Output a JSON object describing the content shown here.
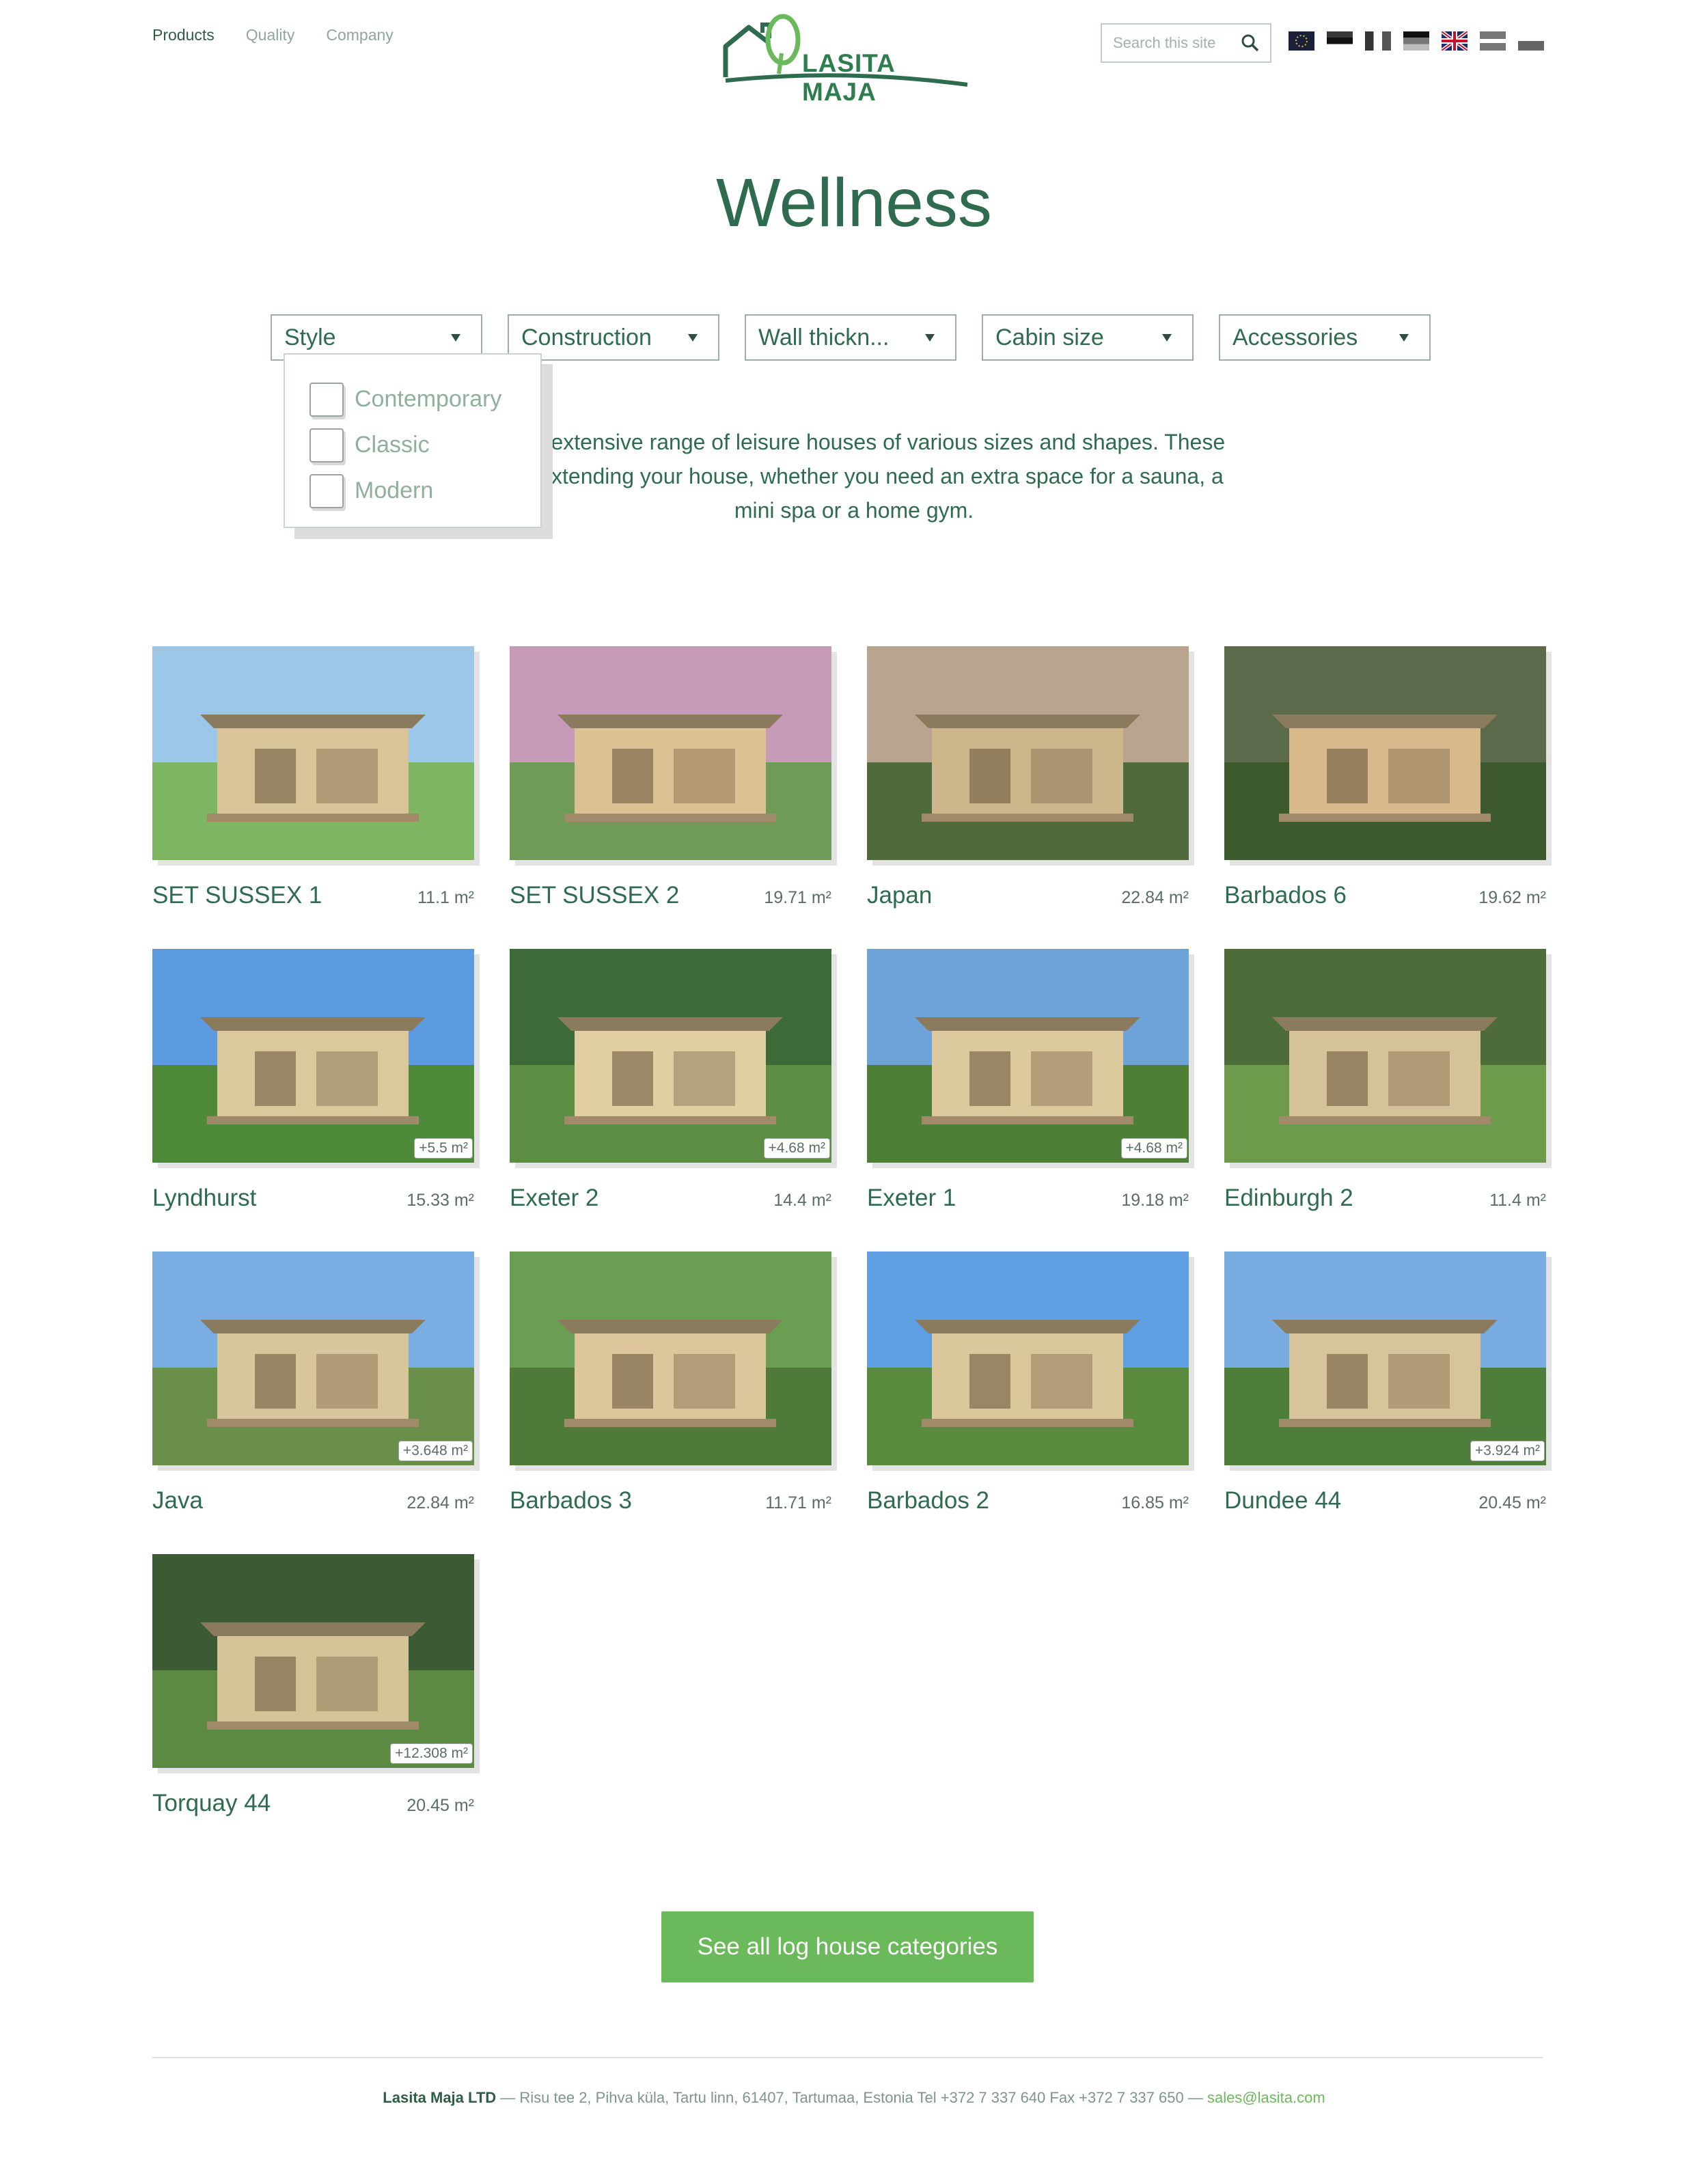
{
  "nav": {
    "items": [
      "Products",
      "Quality",
      "Company"
    ]
  },
  "logo": {
    "text": "LASITA MAJA"
  },
  "search": {
    "placeholder": "Search this site"
  },
  "languages": [
    {
      "name": "eu-flag-icon"
    },
    {
      "name": "estonia-flag-icon"
    },
    {
      "name": "france-flag-icon"
    },
    {
      "name": "germany-flag-icon"
    },
    {
      "name": "uk-flag-icon"
    },
    {
      "name": "latvia-flag-icon"
    },
    {
      "name": "poland-flag-icon"
    }
  ],
  "page": {
    "title": "Wellness"
  },
  "filters": [
    {
      "label": "Style"
    },
    {
      "label": "Construction"
    },
    {
      "label": "Wall thickn..."
    },
    {
      "label": "Cabin size"
    },
    {
      "label": "Accessories"
    }
  ],
  "style_dropdown": {
    "options": [
      "Contemporary",
      "Classic",
      "Modern"
    ]
  },
  "intro": {
    "line1": "nd our extensive range of leisure houses of various sizes and shapes. These",
    "line2": "ct for extending your house, whether you need an extra space for a sauna, a",
    "line3": "mini spa or a home gym."
  },
  "products": [
    {
      "name": "SET SUSSEX 1",
      "area": "11.1 m²",
      "extra": ""
    },
    {
      "name": "SET SUSSEX 2",
      "area": "19.71 m²",
      "extra": ""
    },
    {
      "name": "Japan",
      "area": "22.84 m²",
      "extra": ""
    },
    {
      "name": "Barbados 6",
      "area": "19.62 m²",
      "extra": ""
    },
    {
      "name": "Lyndhurst",
      "area": "15.33 m²",
      "extra": "+5.5 m²"
    },
    {
      "name": "Exeter 2",
      "area": "14.4 m²",
      "extra": "+4.68 m²"
    },
    {
      "name": "Exeter 1",
      "area": "19.18 m²",
      "extra": "+4.68 m²"
    },
    {
      "name": "Edinburgh 2",
      "area": "11.4 m²",
      "extra": ""
    },
    {
      "name": "Java",
      "area": "22.84 m²",
      "extra": "+3.648 m²"
    },
    {
      "name": "Barbados 3",
      "area": "11.71 m²",
      "extra": ""
    },
    {
      "name": "Barbados 2",
      "area": "16.85 m²",
      "extra": ""
    },
    {
      "name": "Dundee 44",
      "area": "20.45 m²",
      "extra": "+3.924 m²"
    },
    {
      "name": "Torquay 44",
      "area": "20.45 m²",
      "extra": "+12.308 m²"
    }
  ],
  "cta": {
    "label": "See all log house categories"
  },
  "footer": {
    "company": "Lasita Maja LTD",
    "address": " — Risu tee 2, Pihva küla, Tartu linn, 61407, Tartumaa, Estonia Tel +372 7 337 640 Fax +372 7 337 650 — ",
    "email": "sales@lasita.com"
  },
  "colors": {
    "brand_green": "#2e6b4f",
    "cta_green": "#6ab95a"
  }
}
